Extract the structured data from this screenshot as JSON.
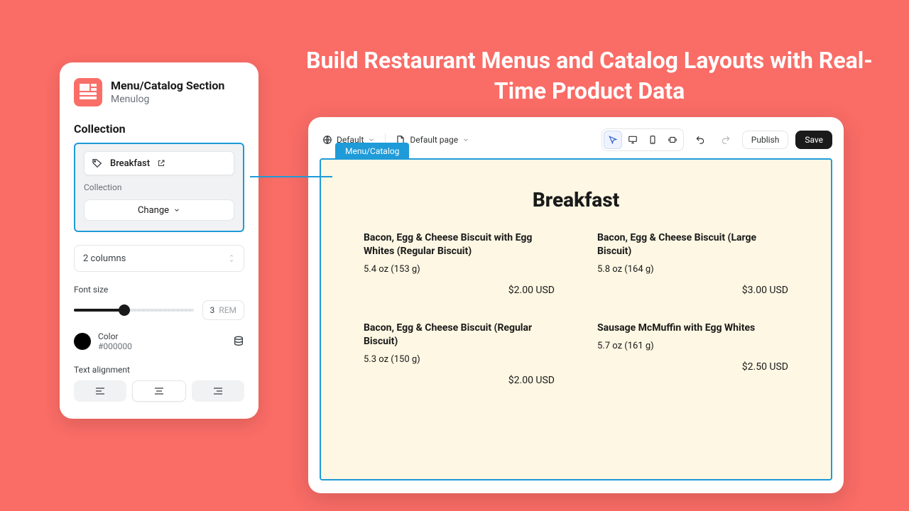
{
  "hero": "Build Restaurant Menus and Catalog Layouts with Real-Time Product Data",
  "panel": {
    "title": "Menu/Catalog Section",
    "subtitle": "Menulog",
    "section": "Collection",
    "selected_collection": "Breakfast",
    "sub_label": "Collection",
    "change_label": "Change",
    "columns_label": "2 columns",
    "font_label": "Font size",
    "font_value": "3",
    "font_unit": "REM",
    "color_label": "Color",
    "color_hex": "#000000",
    "align_label": "Text alignment"
  },
  "toolbar": {
    "theme": "Default",
    "page": "Default page",
    "publish": "Publish",
    "save": "Save"
  },
  "canvas": {
    "tab": "Menu/Catalog",
    "title": "Breakfast",
    "items": [
      {
        "name": "Bacon, Egg & Cheese Biscuit with Egg Whites (Regular Biscuit)",
        "weight": "5.4 oz (153 g)",
        "price": "$2.00 USD"
      },
      {
        "name": "Bacon, Egg & Cheese Biscuit (Large Biscuit)",
        "weight": "5.8 oz (164 g)",
        "price": "$3.00 USD"
      },
      {
        "name": "Bacon, Egg & Cheese Biscuit (Regular Biscuit)",
        "weight": "5.3 oz (150 g)",
        "price": "$2.00 USD"
      },
      {
        "name": "Sausage McMuffin with Egg Whites",
        "weight": "5.7 oz (161 g)",
        "price": "$2.50 USD"
      }
    ]
  }
}
